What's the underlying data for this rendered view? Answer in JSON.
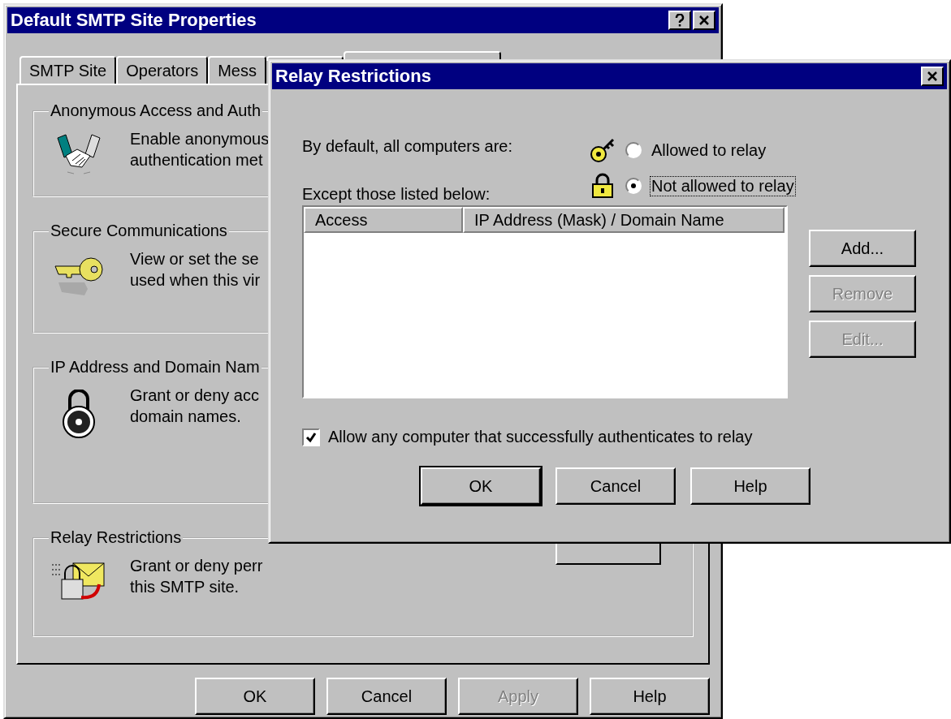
{
  "properties_window": {
    "title": "Default SMTP Site Properties",
    "tabs": [
      {
        "label": "SMTP Site",
        "selected": false
      },
      {
        "label": "Operators",
        "selected": false
      },
      {
        "label": "Mess",
        "selected": false
      },
      {
        "selected": false
      },
      {
        "selected": true
      }
    ],
    "groups": [
      {
        "title": "Anonymous Access and Auth",
        "kind": "handshake",
        "lines": [
          "Enable anonymous",
          "authentication met"
        ]
      },
      {
        "title": "Secure Communications",
        "kind": "key",
        "lines": [
          "View or set the se",
          "used when this vir"
        ]
      },
      {
        "title": "IP Address and Domain Nam",
        "kind": "lock",
        "lines": [
          "Grant or deny acc",
          "domain names."
        ]
      },
      {
        "title": "Relay Restrictions",
        "kind": "relay",
        "lines": [
          "Grant or deny perr",
          "this SMTP site."
        ]
      }
    ],
    "buttons": [
      {
        "label": "OK",
        "disabled": false
      },
      {
        "label": "Cancel",
        "disabled": false
      },
      {
        "label": "Apply",
        "disabled": true
      },
      {
        "label": "Help",
        "disabled": false
      }
    ]
  },
  "relay_dialog": {
    "title": "Relay Restrictions",
    "default_label": "By default, all computers are:",
    "options": [
      {
        "label": "Allowed to relay",
        "kind": "key",
        "selected": false,
        "focused": false
      },
      {
        "label": "Not allowed to relay",
        "kind": "padlock",
        "selected": true,
        "focused": true
      }
    ],
    "except_label": "Except those listed below:",
    "table": {
      "columns": [
        "Access",
        "IP Address (Mask) / Domain Name"
      ]
    },
    "side_buttons": [
      {
        "label": "Add...",
        "disabled": false
      },
      {
        "label": "Remove",
        "disabled": true
      },
      {
        "label": "Edit...",
        "disabled": true
      }
    ],
    "auth_checkbox": {
      "label": "Allow any computer that successfully authenticates to relay",
      "checked": true
    },
    "buttons": [
      {
        "label": "OK",
        "default": true
      },
      {
        "label": "Cancel",
        "default": false
      },
      {
        "label": "Help",
        "default": false
      }
    ]
  }
}
